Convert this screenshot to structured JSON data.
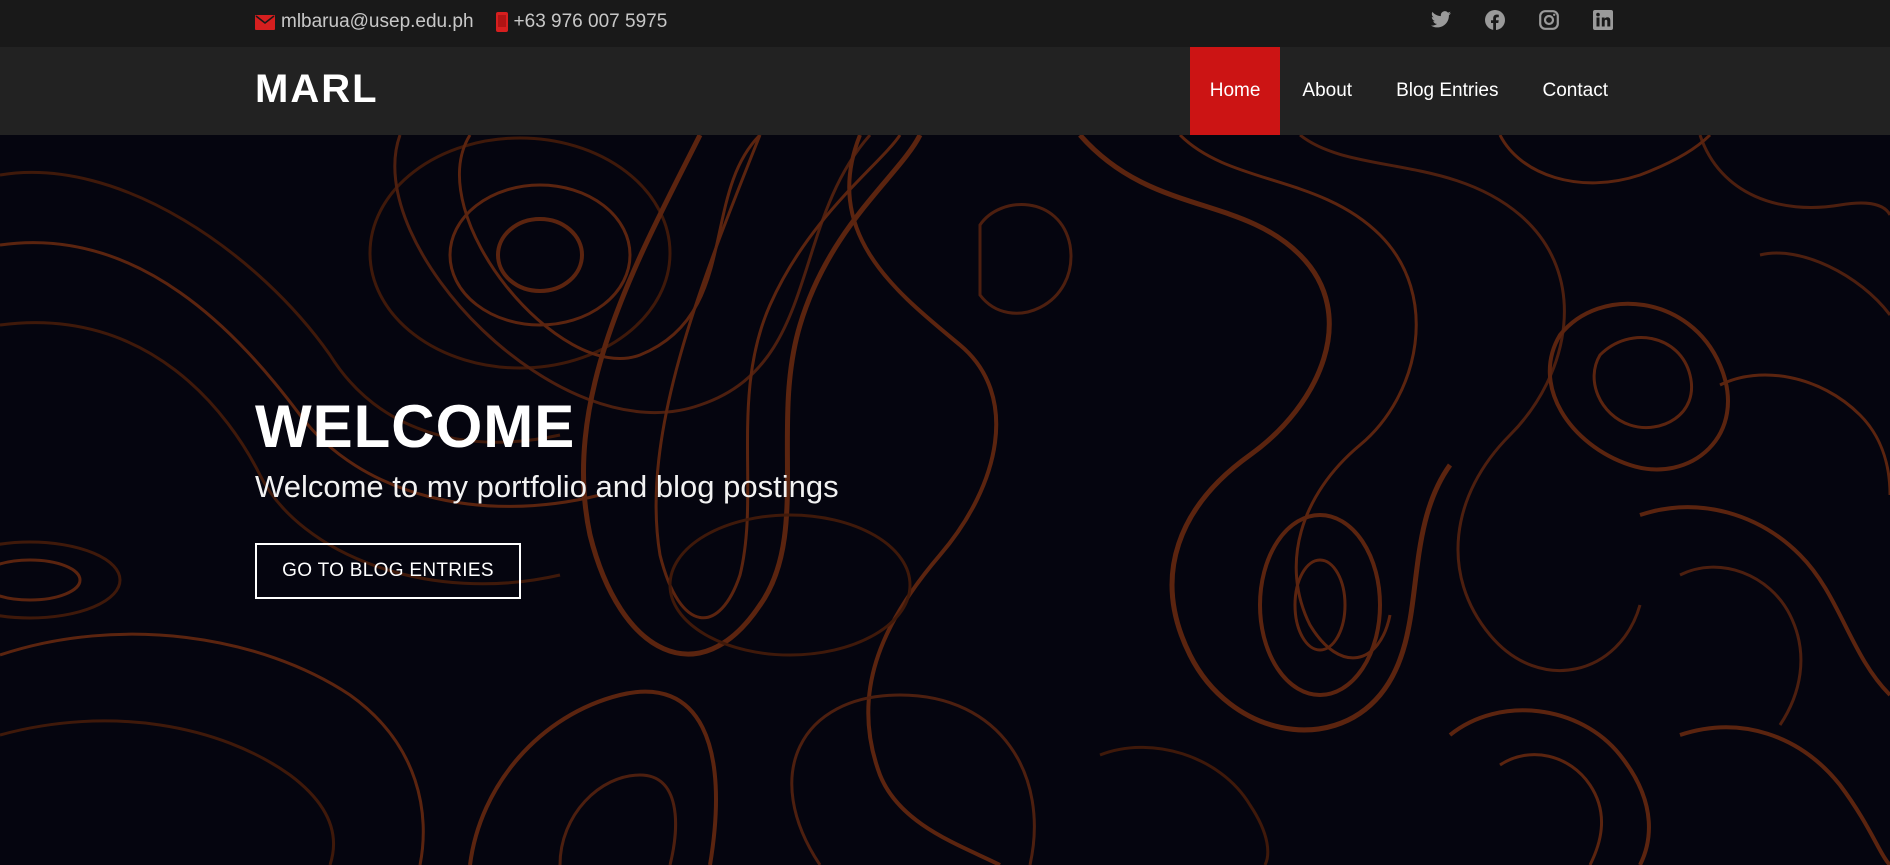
{
  "topbar": {
    "email": "mlbarua@usep.edu.ph",
    "phone": "+63 976 007 5975",
    "icons": {
      "email": "envelope-icon",
      "phone": "mobile-phone-icon",
      "twitter": "twitter-icon",
      "facebook": "facebook-icon",
      "instagram": "instagram-icon",
      "linkedin": "linkedin-icon"
    }
  },
  "header": {
    "logo": "MARL",
    "nav": {
      "home": "Home",
      "about": "About",
      "blog": "Blog Entries",
      "contact": "Contact"
    },
    "active_item": "Home"
  },
  "hero": {
    "title": "WELCOME",
    "subtitle": "Welcome to my portfolio and blog postings",
    "button": "GO TO BLOG ENTRIES"
  },
  "colors": {
    "accent": "#cc1414",
    "topbar_bg": "#191919",
    "header_bg": "#222222",
    "hero_bg": "#05050f",
    "contour": "#6b2a10"
  }
}
